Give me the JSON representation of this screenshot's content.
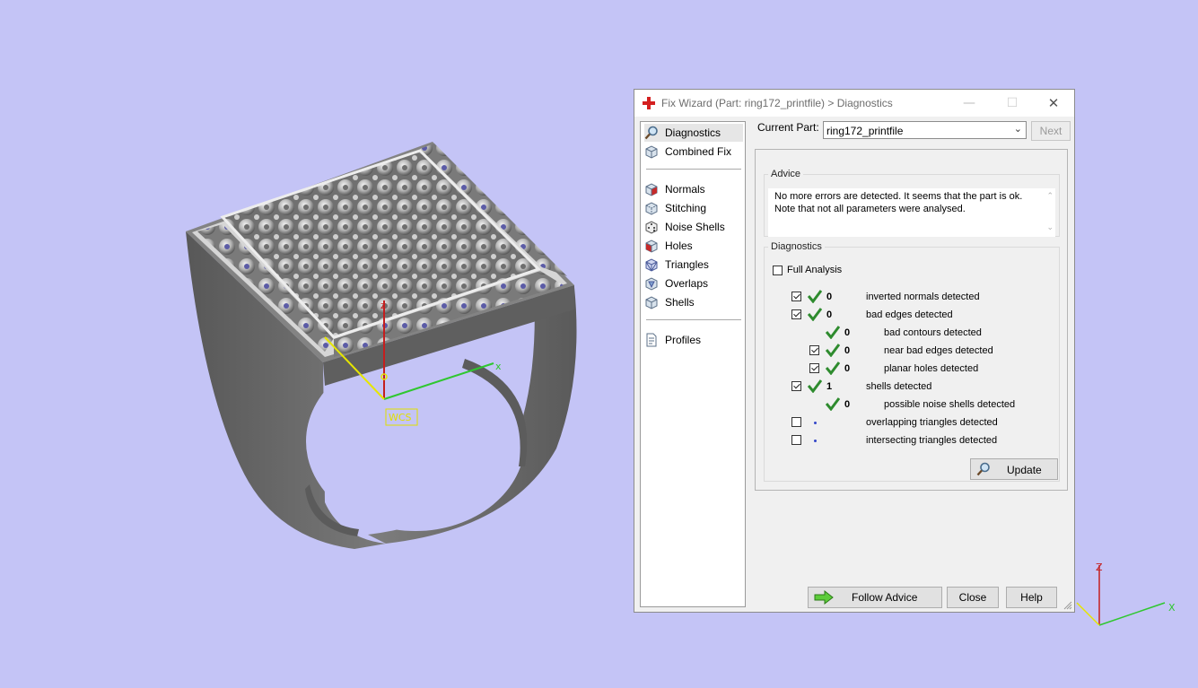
{
  "viewport": {
    "wcs_label": "WCS",
    "model_axis_z": "z",
    "model_axis_x": "x",
    "corner_axis_z": "Z",
    "corner_axis_x": "X"
  },
  "dialog": {
    "title": "Fix Wizard (Part: ring172_printfile) > Diagnostics",
    "titlebar_buttons": {
      "minimize": "—",
      "maximize": "☐",
      "close": "✕"
    },
    "sidebar": {
      "items": [
        {
          "label": "Diagnostics",
          "icon": "magnifier-icon",
          "selected": true
        },
        {
          "label": "Combined Fix",
          "icon": "combined-fix-cube-icon"
        },
        {
          "label": "Normals",
          "icon": "normals-cube-icon"
        },
        {
          "label": "Stitching",
          "icon": "stitching-cube-icon"
        },
        {
          "label": "Noise Shells",
          "icon": "noise-shells-dice-icon"
        },
        {
          "label": "Holes",
          "icon": "holes-cube-icon"
        },
        {
          "label": "Triangles",
          "icon": "triangles-cube-icon"
        },
        {
          "label": "Overlaps",
          "icon": "overlaps-cube-icon"
        },
        {
          "label": "Shells",
          "icon": "shells-cube-icon"
        },
        {
          "label": "Profiles",
          "icon": "profiles-document-icon"
        }
      ]
    },
    "current_part": {
      "label": "Current Part:",
      "value": "ring172_printfile"
    },
    "next_label": "Next",
    "advice": {
      "title": "Advice",
      "line1": "No more errors are detected. It seems that the part is ok.",
      "line2": "Note that not all parameters were analysed."
    },
    "diagnostics": {
      "title": "Diagnostics",
      "full_analysis_label": "Full Analysis",
      "full_analysis_checked": false,
      "rows": [
        {
          "checkbox": true,
          "checked": true,
          "status": "ok",
          "count": "0",
          "label": "inverted normals detected",
          "indent": 0
        },
        {
          "checkbox": true,
          "checked": true,
          "status": "ok",
          "count": "0",
          "label": "bad edges detected",
          "indent": 0
        },
        {
          "checkbox": false,
          "checked": false,
          "status": "ok",
          "count": "0",
          "label": "bad contours detected",
          "indent": 1
        },
        {
          "checkbox": true,
          "checked": true,
          "status": "ok",
          "count": "0",
          "label": "near bad edges detected",
          "indent": 1
        },
        {
          "checkbox": true,
          "checked": true,
          "status": "ok",
          "count": "0",
          "label": "planar holes detected",
          "indent": 1
        },
        {
          "checkbox": true,
          "checked": true,
          "status": "ok",
          "count": "1",
          "label": "shells detected",
          "indent": 0
        },
        {
          "checkbox": false,
          "checked": false,
          "status": "ok",
          "count": "0",
          "label": "possible noise shells detected",
          "indent": 1
        },
        {
          "checkbox": true,
          "checked": false,
          "status": "not-analysed",
          "count": "",
          "label": "overlapping triangles detected",
          "indent": 0
        },
        {
          "checkbox": true,
          "checked": false,
          "status": "not-analysed",
          "count": "",
          "label": "intersecting triangles detected",
          "indent": 0
        }
      ],
      "update_label": "Update"
    },
    "buttons": {
      "follow_advice": "Follow Advice",
      "close": "Close",
      "help": "Help"
    }
  },
  "colors": {
    "background": "#c4c4f6",
    "ring_gray": "#6b6b6b",
    "ok_check": "#2e8b2e",
    "z_axis": "#c41e1e",
    "x_axis": "#2fc72f",
    "y_axis": "#e6e600"
  }
}
